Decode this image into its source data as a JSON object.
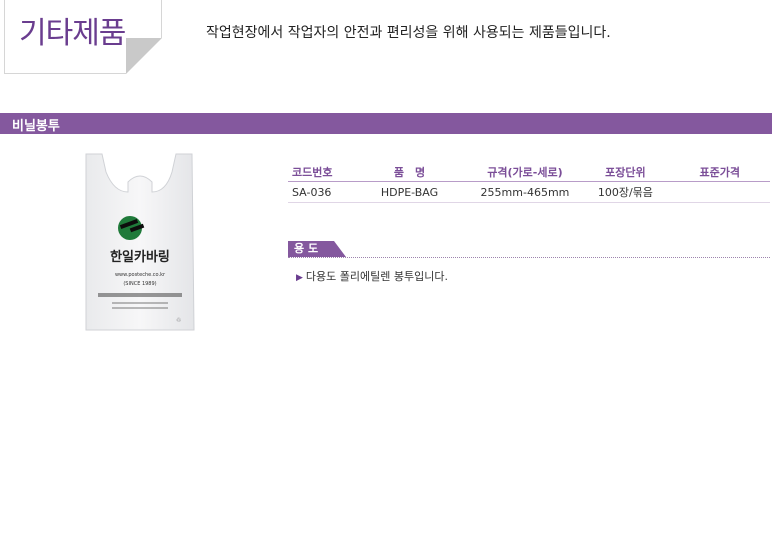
{
  "header": {
    "title": "기타제품",
    "intro": "작업현장에서 작업자의 안전과 편리성을 위해 사용되는 제품들입니다."
  },
  "section": {
    "label": "비닐봉투"
  },
  "product_image": {
    "brand": "한일카바링",
    "url": "www.posteche.co.kr",
    "since": "(SINCE 1989)"
  },
  "spec_table": {
    "headers": [
      "코드번호",
      "품　명",
      "규격(가로-세로)",
      "포장단위",
      "표준가격"
    ],
    "rows": [
      [
        "SA-036",
        "HDPE-BAG",
        "255mm-465mm",
        "100장/묶음",
        ""
      ]
    ]
  },
  "usage": {
    "label": "용 도",
    "items": [
      "다용도 폴리에틸렌 봉투입니다."
    ]
  },
  "colors": {
    "accent": "#84589e",
    "title": "#6a3d8f"
  }
}
